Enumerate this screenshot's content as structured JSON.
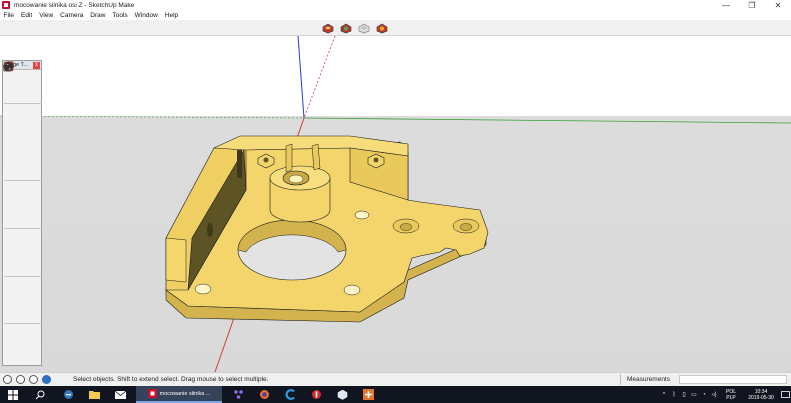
{
  "window": {
    "title": "mocowanie silnika osi Z - SketchUp Make",
    "controls": {
      "minimize": "—",
      "maximize": "❐",
      "close": "✕"
    }
  },
  "menu": [
    "File",
    "Edit",
    "View",
    "Camera",
    "Draw",
    "Tools",
    "Window",
    "Help"
  ],
  "toolbar": {
    "scene_tools": [
      "components-icon",
      "materials-icon",
      "scene-icon",
      "extension-icon"
    ]
  },
  "palette": {
    "title": "Large T...",
    "close": "x",
    "tools": [
      [
        "select-icon",
        "component-icon"
      ],
      [
        "paint-bucket-icon",
        "eraser-icon"
      ],
      [
        "line-icon",
        "freehand-icon"
      ],
      [
        "rectangle-icon",
        "rotated-rectangle-icon"
      ],
      [
        "circle-icon",
        "polygon-icon"
      ],
      [
        "arc-icon",
        "pie-icon"
      ],
      [
        "two-point-arc-icon",
        "three-point-arc-icon"
      ],
      [
        "move-icon",
        "push-pull-icon"
      ],
      [
        "rotate-icon",
        "follow-me-icon"
      ],
      [
        "scale-icon",
        "offset-icon"
      ],
      [
        "tape-measure-icon",
        "dimension-icon"
      ],
      [
        "protractor-icon",
        "text-icon"
      ],
      [
        "axes-icon",
        "3d-text-icon"
      ],
      [
        "orbit-icon",
        "pan-icon"
      ],
      [
        "zoom-icon",
        "zoom-window-icon"
      ],
      [
        "zoom-extents-icon",
        "previous-view-icon"
      ],
      [
        "position-camera-icon",
        "look-around-icon"
      ],
      [
        "walk-icon",
        "section-plane-icon"
      ]
    ]
  },
  "status": {
    "hint": "Select objects. Shift to extend select. Drag mouse to select multiple.",
    "measurements_label": "Measurements",
    "measurements_value": ""
  },
  "taskbar": {
    "active_app_label": "mocowanie silnika ...",
    "lang_line1": "POL",
    "lang_line2": "PLP",
    "time": "10:34",
    "date": "2019-05-30"
  },
  "colors": {
    "model_face": "#f3d56c",
    "model_side": "#d2b34e",
    "model_dark": "#5e5324",
    "model_edge": "#1b1b1b",
    "axis_red": "#d43b3b",
    "axis_green": "#3aa03a",
    "axis_blue": "#2a3bd6",
    "taskbar": "#10151f"
  }
}
